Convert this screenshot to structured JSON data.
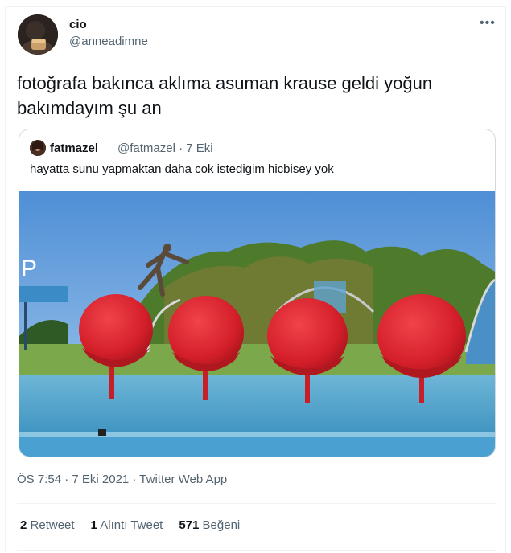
{
  "tweet": {
    "display_name": "cio",
    "handle": "@anneadimne",
    "more_icon": "•••",
    "text": "fotoğrafa bakınca aklıma asuman krause geldi yoğun bakımdayım şu an",
    "timestamp": "ÖS 7:54 · 7 Eki 2021 · Twitter Web App"
  },
  "quoted": {
    "display_name": "fatmazel",
    "handle_time": "@fatmazel · 7 Eki",
    "text": "hayatta sunu yapmaktan daha cok istedigim hicbisey yok"
  },
  "stats": {
    "retweet_count": "2",
    "retweet_label": "Retweet",
    "quote_count": "1",
    "quote_label": "Alıntı Tweet",
    "like_count": "571",
    "like_label": "Beğeni"
  },
  "colors": {
    "text_primary": "#0f1419",
    "text_secondary": "#536471",
    "border": "#cfd9de",
    "ball_red": "#d9232d"
  },
  "icons": {
    "more": "more-icon"
  }
}
